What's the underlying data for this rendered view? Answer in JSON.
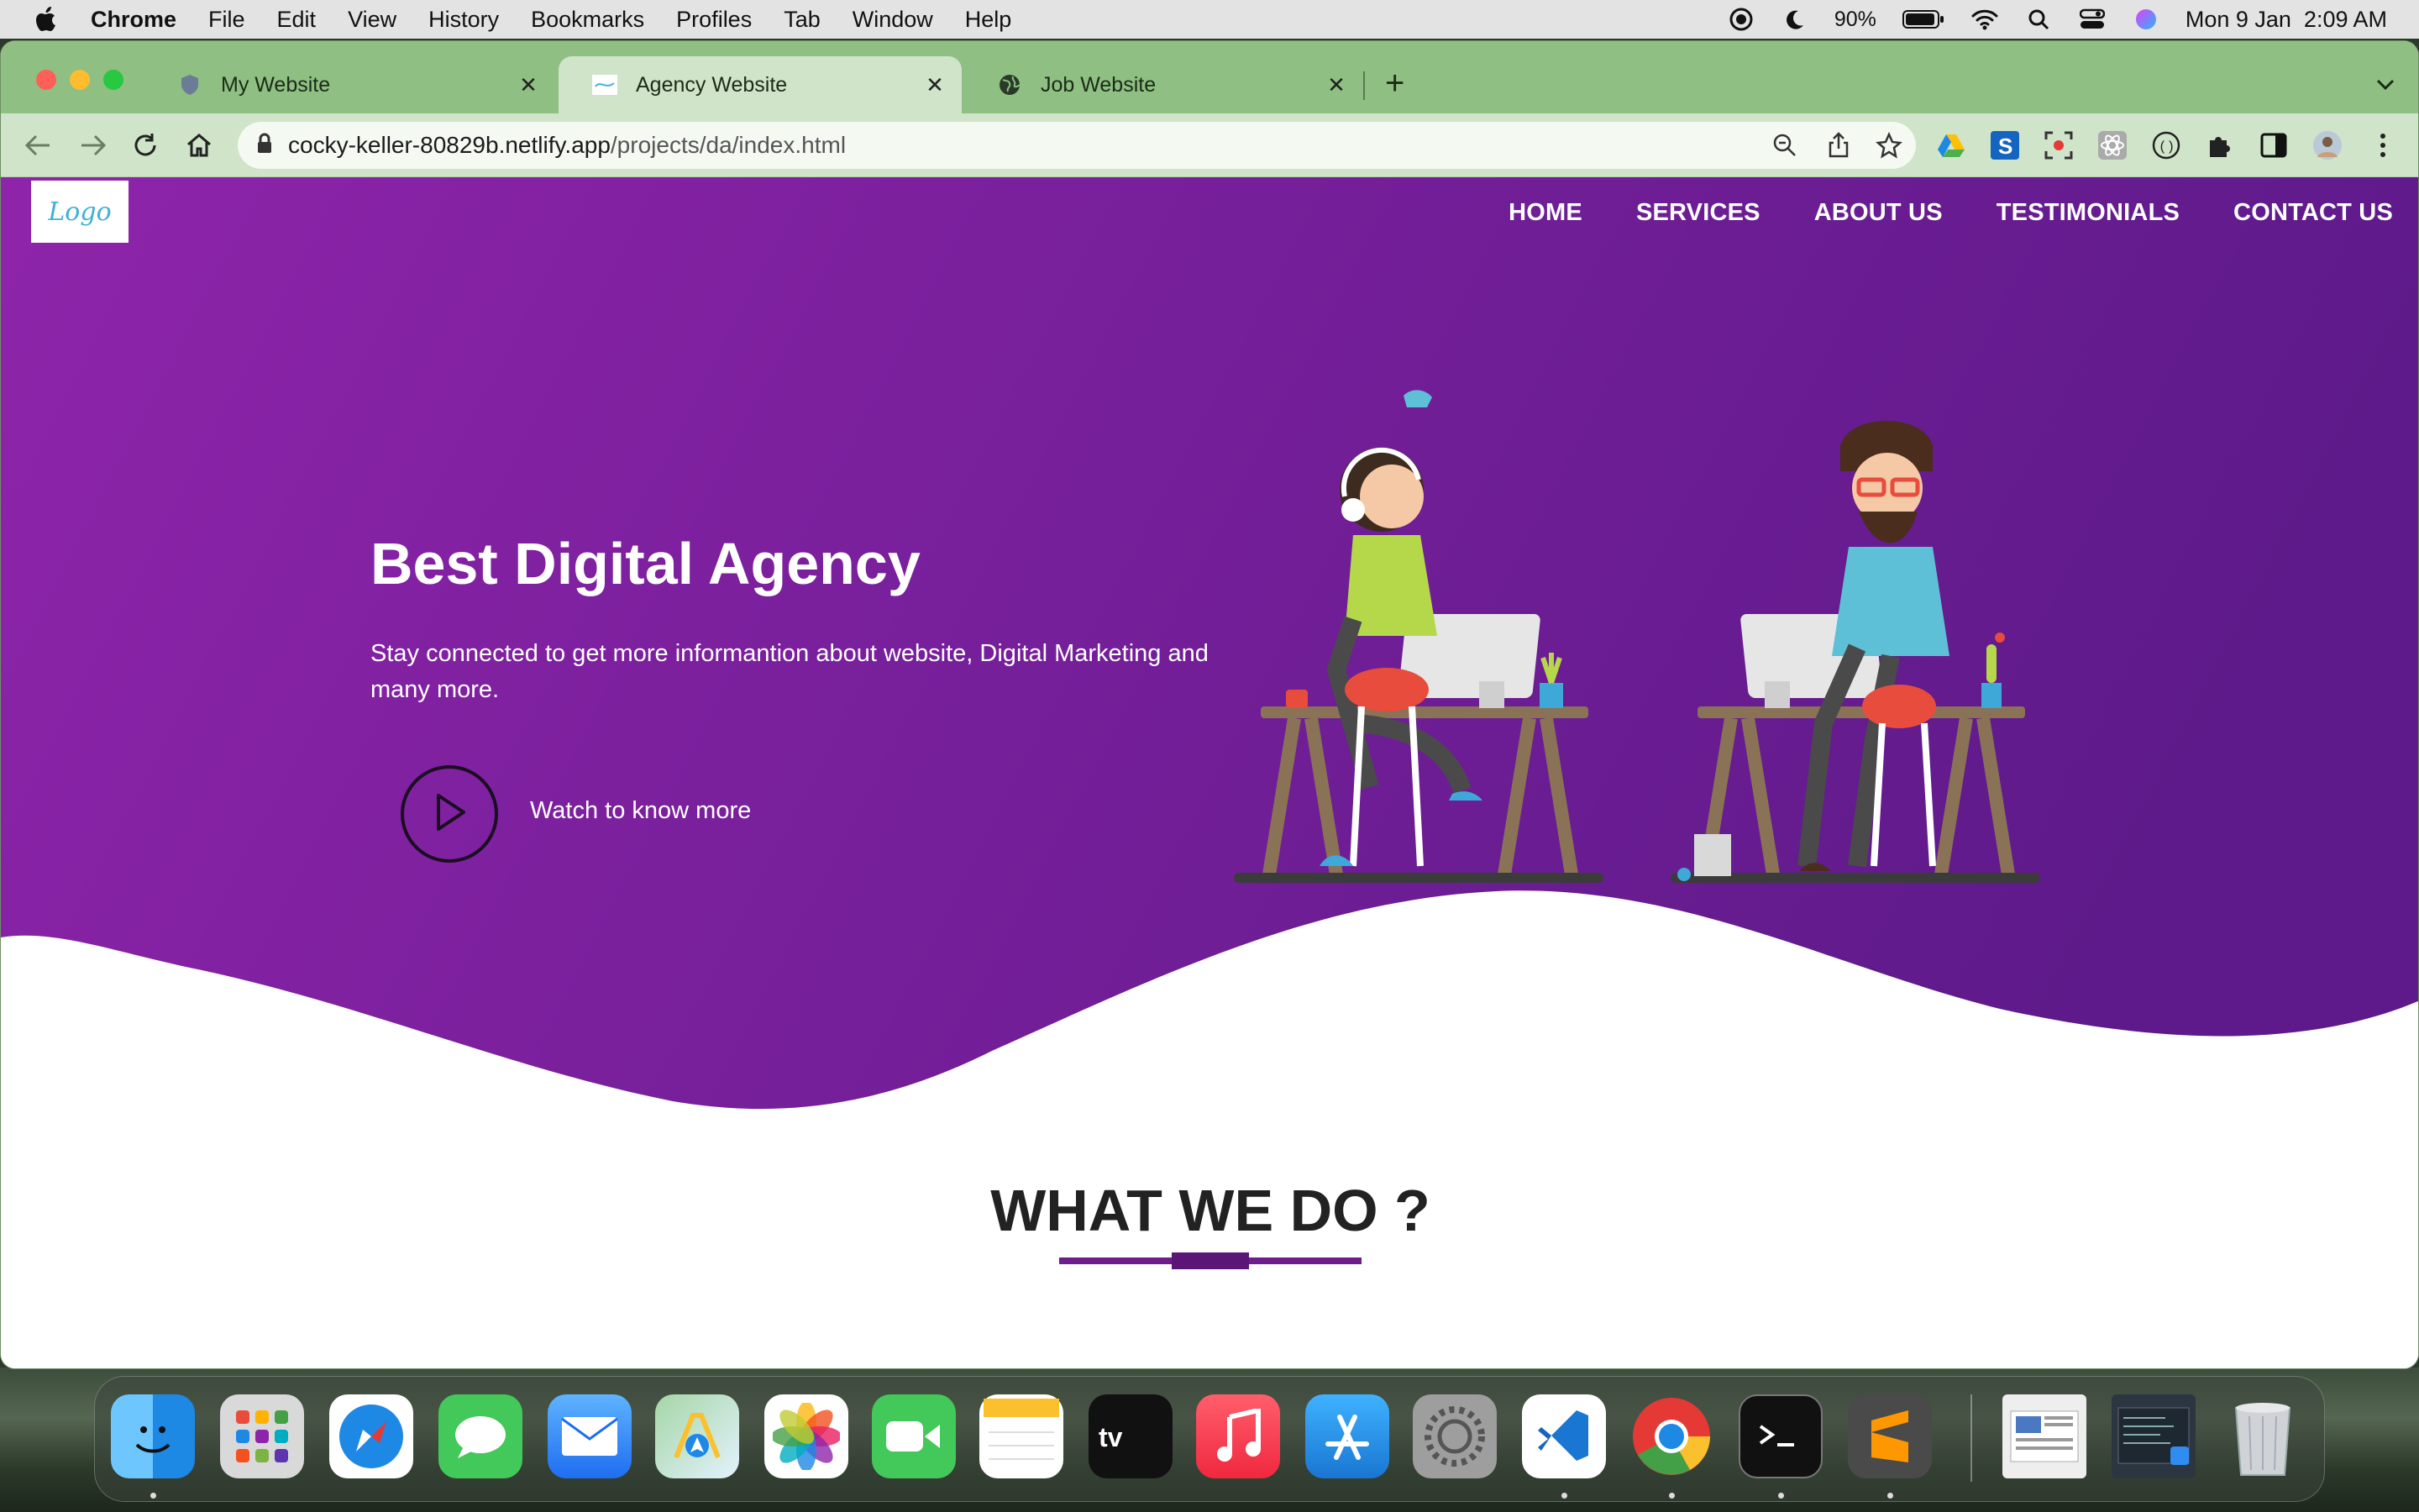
{
  "menubar": {
    "app_name": "Chrome",
    "items": [
      "File",
      "Edit",
      "View",
      "History",
      "Bookmarks",
      "Profiles",
      "Tab",
      "Window",
      "Help"
    ],
    "battery": "90%",
    "datetime": "Mon 9 Jan  2:09 AM"
  },
  "browser": {
    "tabs": [
      {
        "title": "My Website",
        "icon": "shield-favicon"
      },
      {
        "title": "Agency Website",
        "icon": "logo-favicon"
      },
      {
        "title": "Job Website",
        "icon": "globe-icon"
      }
    ],
    "url_host": "cocky-keller-80829b.netlify.app",
    "url_path": "/projects/da/index.html"
  },
  "site": {
    "logo_text": "Logo",
    "nav": [
      "HOME",
      "SERVICES",
      "ABOUT US",
      "TESTIMONIALS",
      "CONTACT US"
    ],
    "hero": {
      "title": "Best Digital Agency",
      "subtitle": "Stay connected to get more informantion about website, Digital Marketing and many more.",
      "cta": "Watch to know more"
    },
    "section_title": "WHAT WE DO ?"
  },
  "colors": {
    "hero_gradient_start": "#8e24aa",
    "hero_gradient_end": "#5e1a8a",
    "tab_strip": "#8fbf82"
  },
  "dock": [
    "Finder",
    "Launchpad",
    "Safari",
    "Messages",
    "Mail",
    "Maps",
    "Photos",
    "FaceTime",
    "Notes",
    "TV",
    "Music",
    "App Store",
    "System Settings",
    "Visual Studio Code",
    "Google Chrome",
    "Terminal",
    "Sublime Text",
    "Documents",
    "Downloads",
    "Trash"
  ]
}
